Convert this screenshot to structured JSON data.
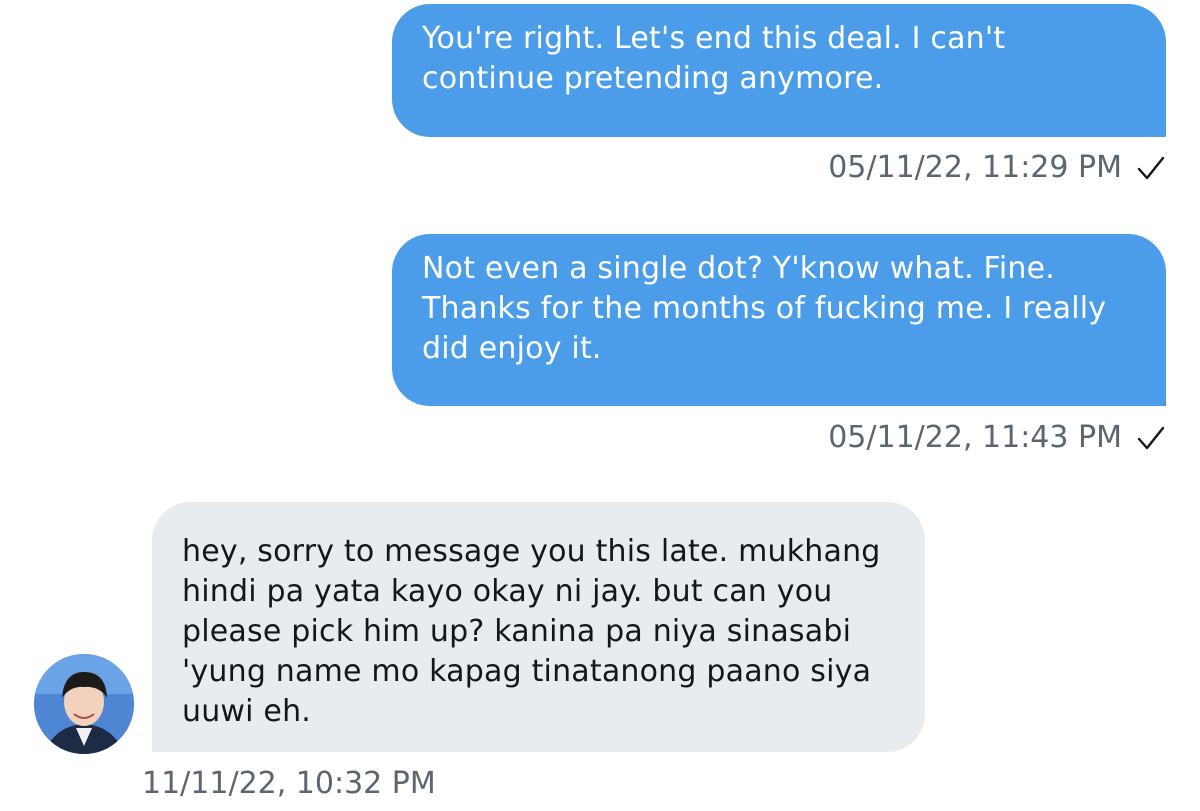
{
  "conversation": {
    "messages": [
      {
        "direction": "sent",
        "text": "You're right. Let's end this deal. I can't\ncontinue pretending anymore.",
        "timestamp": "05/11/22, 11:29 PM",
        "status_icon": "checkmark-icon"
      },
      {
        "direction": "sent",
        "text": "Not even a single dot? Y'know what. Fine.\nThanks for the months of fucking me. I really\ndid enjoy it.",
        "timestamp": "05/11/22, 11:43 PM",
        "status_icon": "checkmark-icon"
      },
      {
        "direction": "received",
        "text": "hey, sorry to message you this late. mukhang\nhindi pa yata kayo okay ni jay. but can you\nplease pick him up? kanina pa niya sinasabi\n'yung name mo kapag tinatanong paano siya\nuuwi eh.",
        "timestamp": "11/11/22, 10:32 PM",
        "avatar": "user-avatar"
      }
    ]
  },
  "colors": {
    "sent_bubble": "#4b9de9",
    "received_bubble": "#e8ecef",
    "timestamp": "#5b6670"
  }
}
